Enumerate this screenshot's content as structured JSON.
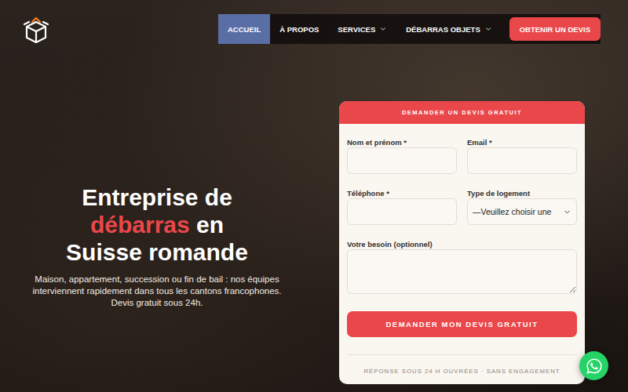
{
  "nav": {
    "items": [
      {
        "label": "ACCUEIL",
        "selected": true,
        "kind": "link"
      },
      {
        "label": "À PROPOS",
        "selected": false,
        "kind": "link"
      },
      {
        "label": "SERVICES",
        "selected": false,
        "kind": "dropdown"
      },
      {
        "label": "DÉBARRAS OBJETS",
        "selected": false,
        "kind": "dropdown"
      }
    ],
    "cta": "OBTENIR UN DEVIS"
  },
  "hero": {
    "title_lines": [
      [
        {
          "text": "Entreprise de",
          "highlight": false
        }
      ],
      [
        {
          "text": "débarras",
          "highlight": true
        },
        {
          "text": "en",
          "highlight": false
        }
      ],
      [
        {
          "text": "Suisse romande",
          "highlight": false
        }
      ]
    ],
    "text": "Maison, appartement, succession ou fin de bail : nos équipes interviennent rapidement dans tous les cantons francophones. Devis gratuit sous 24h."
  },
  "form": {
    "title": "DEMANDER UN DEVIS GRATUIT",
    "fields": [
      {
        "label": "Nom et prénom *",
        "kind": "input",
        "value": ""
      },
      {
        "label": "Email *",
        "kind": "input",
        "value": ""
      },
      {
        "label": "Téléphone *",
        "kind": "input",
        "value": ""
      },
      {
        "label": "Type de logement",
        "kind": "select",
        "value": "—Veuillez choisir une"
      },
      {
        "label": "Votre besoin (optionnel)",
        "kind": "textarea",
        "value": ""
      }
    ],
    "submit": "DEMANDER MON DEVIS GRATUIT",
    "note": "RÉPONSE SOUS 24 H OUVRÉES · SANS ENGAGEMENT"
  }
}
